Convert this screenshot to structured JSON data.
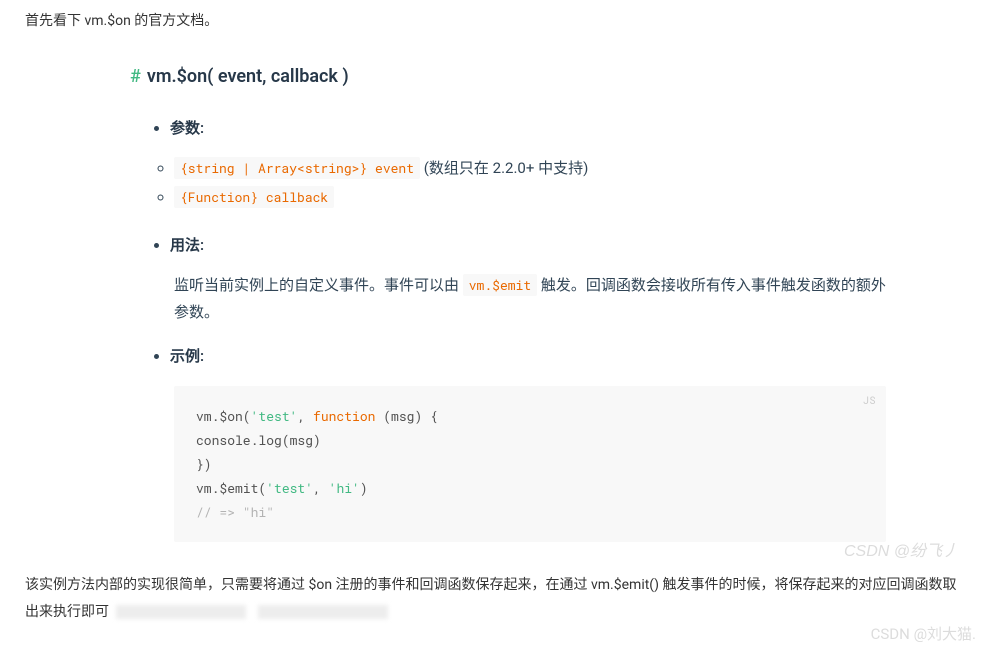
{
  "intro": "首先看下 vm.$on 的官方文档。",
  "heading": {
    "hash": "#",
    "title": "vm.$on( event, callback )"
  },
  "sections": {
    "params": {
      "label": "参数",
      "items": [
        {
          "code": "{string | Array<string>} event",
          "note": "(数组只在 2.2.0+ 中支持)"
        },
        {
          "code": "{Function} callback",
          "note": ""
        }
      ]
    },
    "usage": {
      "label": "用法",
      "text_before": "监听当前实例上的自定义事件。事件可以由 ",
      "code": "vm.$emit",
      "text_after": " 触发。回调函数会接收所有传入事件触发函数的额外参数。"
    },
    "example": {
      "label": "示例",
      "lang": "JS",
      "code": {
        "l1_a": "vm.$on(",
        "l1_b": "'test'",
        "l1_c": ", ",
        "l1_d": "function",
        "l1_e": " (msg) {",
        "l2_a": "  console",
        "l2_b": ".log(msg)",
        "l3": "})",
        "l4_a": "vm.$emit(",
        "l4_b": "'test'",
        "l4_c": ", ",
        "l4_d": "'hi'",
        "l4_e": ")",
        "l5": "// => \"hi\""
      }
    }
  },
  "bottom": "该实例方法内部的实现很简单，只需要将通过 $on 注册的事件和回调函数保存起来，在通过 vm.$emit() 触发事件的时候，将保存起来的对应回调函数取出来执行即可",
  "watermark1": "CSDN @纷飞丿",
  "watermark2": "CSDN @刘大猫."
}
